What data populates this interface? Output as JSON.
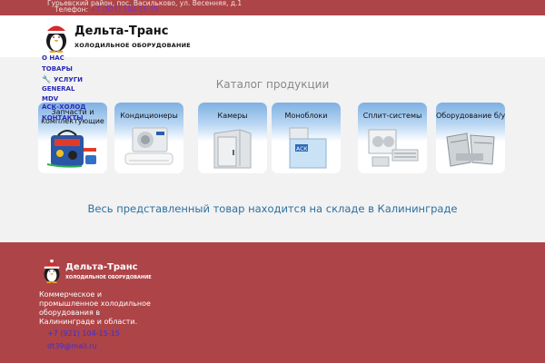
{
  "topbar": {
    "address": "Гурьевский район, пос. Васильково, ул. Весенняя, д.1",
    "phone_label": "Телефон:",
    "phone": "+7 (921) 104-15-15"
  },
  "header": {
    "brand": "Дельта-Транс",
    "subtitle": "ХОЛОДИЛЬНОЕ ОБОРУДОВАНИЕ"
  },
  "nav": {
    "items": [
      {
        "label": "О НАС"
      },
      {
        "label": "ТОВАРЫ"
      },
      {
        "label": "УСЛУГИ",
        "icon": "wrench-icon"
      },
      {
        "label": "GENERAL"
      },
      {
        "label": "MDV"
      },
      {
        "label": "АСК-ХОЛОД"
      },
      {
        "label": "КОНТАКТЫ"
      }
    ]
  },
  "catalog": {
    "title": "Каталог продукции",
    "cards": [
      {
        "label": "Запчасти и комплектующие",
        "icon": "tools-bag-icon"
      },
      {
        "label": "Кондиционеры",
        "icon": "air-conditioner-icon"
      },
      {
        "label": "Камеры",
        "icon": "cold-room-icon"
      },
      {
        "label": "Моноблоки",
        "icon": "monoblock-icon"
      },
      {
        "label": "Сплит-системы",
        "icon": "split-system-icon"
      },
      {
        "label": "Оборудование б/у",
        "icon": "used-equipment-icon"
      }
    ],
    "stock_note": "Весь представленный товар находится на складе в Калининграде"
  },
  "footer": {
    "brand": "Дельта-Транс",
    "subtitle": "ХОЛОДИЛЬНОЕ ОБОРУДОВАНИЕ",
    "description": "Коммерческое и промышленное холодильное оборудования в Калининграде и области.",
    "phone": "+7 (921) 104-15-15",
    "email": "dt39@mail.ru"
  },
  "colors": {
    "brand_red": "#ad4447",
    "nav_blue": "#2a2ab8",
    "note_blue": "#2f6f9f",
    "card_gradient_top": "#7fb0e2"
  }
}
